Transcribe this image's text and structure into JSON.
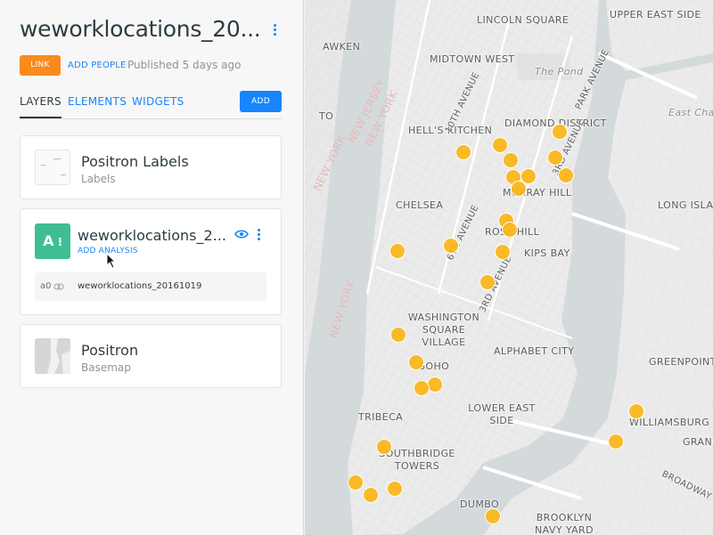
{
  "app": {
    "title": "weworklocations_20...",
    "link_label": "LINK",
    "add_people_label": "ADD PEOPLE",
    "published": "Published 5 days ago"
  },
  "tabs": [
    {
      "label": "LAYERS"
    },
    {
      "label": "ELEMENTS"
    },
    {
      "label": "WIDGETS"
    }
  ],
  "add_label": "ADD",
  "layers": [
    {
      "title": "Positron Labels",
      "subtitle": "Labels"
    },
    {
      "title": "weworklocations_2...",
      "action": "ADD ANALYSIS",
      "badge": "A",
      "analysis_id": "a0",
      "analysis_name": "weworklocations_20161019"
    },
    {
      "title": "Positron",
      "subtitle": "Basemap"
    }
  ],
  "colors": {
    "accent": "#1785fb",
    "link": "#fa8a1e",
    "analysis": "#3fbe96",
    "point": "#fbb71c"
  },
  "map": {
    "labels": [
      "LINCOLN SQUARE",
      "UPPER EAST SIDE",
      "AWKEN",
      "MIDTOWN WEST",
      "The Pond",
      "HELL'S KITCHEN",
      "DIAMOND DISTRICT",
      "East Channel",
      "MURRAY HILL",
      "CHELSEA",
      "LONG ISLAND CITY",
      "ROSE HILL",
      "KIPS BAY",
      "WASHINGTON SQUARE VILLAGE",
      "ALPHABET CITY",
      "GREENPOINT",
      "SOHO",
      "LOWER EAST SIDE",
      "TRIBECA",
      "WILLIAMSBURG",
      "GRAND",
      "SOUTHBRIDGE TOWERS",
      "BROADWAY",
      "DUMBO",
      "BROOKLYN NAVY YARD",
      "10TH AVENUE",
      "PARK AVENUE",
      "3RD AVENUE",
      "6TH AVENUE",
      "3RD AVENUE",
      "NEW JERSEY",
      "NEW YORK",
      "NEW YORK",
      "NEW YORK",
      "TO"
    ]
  }
}
